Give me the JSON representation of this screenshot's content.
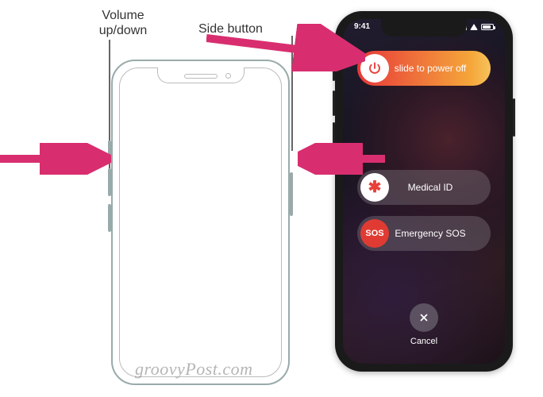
{
  "labels": {
    "volume": "Volume up/down",
    "side_button": "Side button"
  },
  "watermark": "groovyPost.com",
  "statusbar": {
    "time": "9:41"
  },
  "sliders": {
    "power_off": "slide to power off",
    "medical_id": "Medical ID",
    "medical_symbol": "✱",
    "sos": "Emergency SOS",
    "sos_symbol": "SOS"
  },
  "cancel": {
    "label": "Cancel"
  },
  "arrows": {
    "left_to_volume": {
      "desc": "arrow pointing right at volume buttons"
    },
    "side_to_render": {
      "desc": "arrow from Side button label to rendered phone"
    },
    "render_to_side": {
      "desc": "arrow from rendered phone back to side button on outline"
    }
  }
}
